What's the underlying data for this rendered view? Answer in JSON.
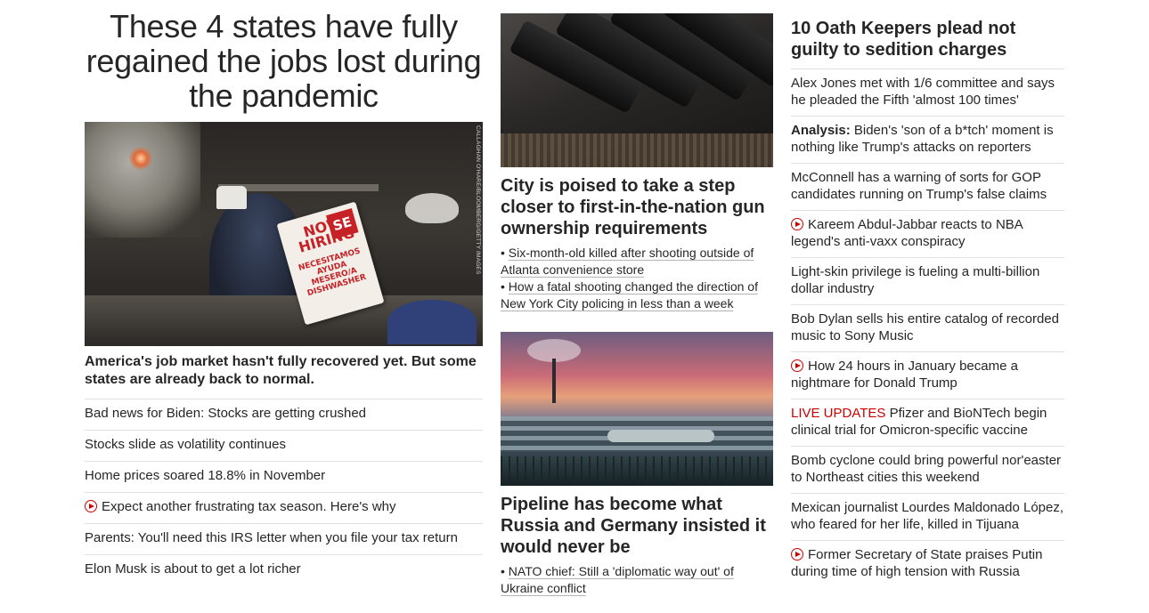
{
  "col1": {
    "headline": "These 4 states have fully regained the jobs lost during the pandemic",
    "photo_credit": "CALLAGHAN O'HARE/BLOOMBERG/GETTY IMAGES",
    "sign": {
      "now_hiring": "NOW HIRING",
      "se": "SE",
      "necesitamos": "NECESITAMOS AYUDA MESERO/A DISHWASHER"
    },
    "summary": "America's job market hasn't fully recovered yet. But some states are already back to normal.",
    "links": [
      {
        "text": "Bad news for Biden: Stocks are getting crushed",
        "video": false
      },
      {
        "text": "Stocks slide as volatility continues",
        "video": false
      },
      {
        "text": "Home prices soared 18.8% in November",
        "video": false
      },
      {
        "text": "Expect another frustrating tax season. Here's why",
        "video": true
      },
      {
        "text": "Parents: You'll need this IRS letter when you file your tax return",
        "video": false
      },
      {
        "text": "Elon Musk is about to get a lot richer",
        "video": false
      }
    ]
  },
  "col2": {
    "story1": {
      "headline": "City is poised to take a step closer to first-in-the-nation gun ownership requirements",
      "bullets": [
        "Six-month-old killed after shooting outside of Atlanta convenience store",
        "How a fatal shooting changed the direction of New York City policing in less than a week"
      ]
    },
    "story2": {
      "headline": "Pipeline has become what Russia and Germany insisted it would never be",
      "bullets": [
        "NATO chief: Still a 'diplomatic way out' of Ukraine conflict"
      ]
    }
  },
  "col3": {
    "headline": "10 Oath Keepers plead not guilty to sedition charges",
    "links": [
      {
        "text": "Alex Jones met with 1/6 committee and says he pleaded the Fifth 'almost 100 times'",
        "prefix": "",
        "video": false,
        "live": ""
      },
      {
        "text": "Biden's 'son of a b*tch' moment is nothing like Trump's attacks on reporters",
        "prefix": "Analysis:",
        "video": false,
        "live": ""
      },
      {
        "text": "McConnell has a warning of sorts for GOP candidates running on Trump's false claims",
        "prefix": "",
        "video": false,
        "live": ""
      },
      {
        "text": "Kareem Abdul-Jabbar reacts to NBA legend's anti-vaxx conspiracy",
        "prefix": "",
        "video": true,
        "live": ""
      },
      {
        "text": "Light-skin privilege is fueling a multi-billion dollar industry",
        "prefix": "",
        "video": false,
        "live": ""
      },
      {
        "text": "Bob Dylan sells his entire catalog of recorded music to Sony Music",
        "prefix": "",
        "video": false,
        "live": ""
      },
      {
        "text": "How 24 hours in January became a nightmare for Donald Trump",
        "prefix": "",
        "video": true,
        "live": ""
      },
      {
        "text": "Pfizer and BioNTech begin clinical trial for Omicron-specific vaccine",
        "prefix": "",
        "video": false,
        "live": "LIVE UPDATES"
      },
      {
        "text": "Bomb cyclone could bring powerful nor'easter to Northeast cities this weekend",
        "prefix": "",
        "video": false,
        "live": ""
      },
      {
        "text": "Mexican journalist Lourdes Maldonado López, who feared for her life, killed in Tijuana",
        "prefix": "",
        "video": false,
        "live": ""
      },
      {
        "text": "Former Secretary of State praises Putin during time of high tension with Russia",
        "prefix": "",
        "video": true,
        "live": ""
      }
    ]
  },
  "colors": {
    "live": "#cc0000",
    "text": "#262626",
    "divider": "#e0e0e0"
  },
  "icons": {
    "video": "play-circle-icon"
  }
}
